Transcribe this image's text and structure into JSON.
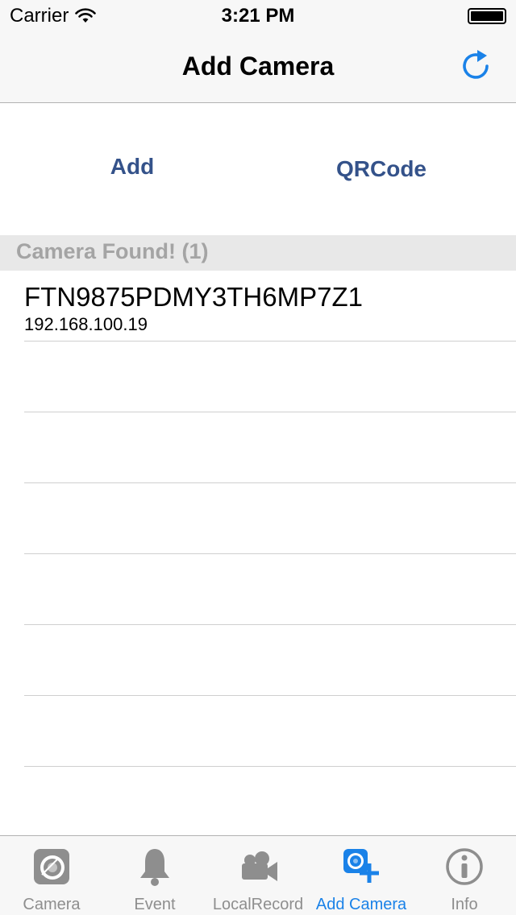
{
  "status": {
    "carrier": "Carrier",
    "time": "3:21 PM",
    "battery_level": 1.0
  },
  "nav": {
    "title": "Add Camera",
    "right_icon": "refresh-icon"
  },
  "actions": {
    "add_label": "Add",
    "qrcode_label": "QRCode"
  },
  "section": {
    "title": "Camera Found! (1)"
  },
  "cameras": [
    {
      "uid": "FTN9875PDMY3TH6MP7Z1",
      "ip": "192.168.100.19"
    },
    {
      "uid": "",
      "ip": ""
    },
    {
      "uid": "",
      "ip": ""
    },
    {
      "uid": "",
      "ip": ""
    },
    {
      "uid": "",
      "ip": ""
    },
    {
      "uid": "",
      "ip": ""
    },
    {
      "uid": "",
      "ip": ""
    }
  ],
  "tabs": [
    {
      "label": "Camera",
      "icon": "camera-lens-icon",
      "active": false
    },
    {
      "label": "Event",
      "icon": "bell-icon",
      "active": false
    },
    {
      "label": "LocalRecord",
      "icon": "video-camera-icon",
      "active": false
    },
    {
      "label": "Add Camera",
      "icon": "add-camera-icon",
      "active": true
    },
    {
      "label": "Info",
      "icon": "info-icon",
      "active": false
    }
  ],
  "colors": {
    "accent": "#1a82e8",
    "action_text": "#34528a",
    "section_bg": "#e8e8e8",
    "section_text": "#a4a4a4",
    "tab_inactive": "#8e8e8e"
  }
}
